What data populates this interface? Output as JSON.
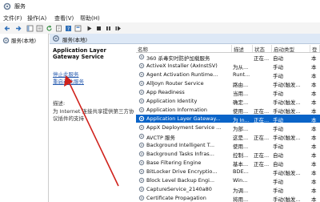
{
  "window": {
    "title": "服务"
  },
  "menu": [
    "文件(F)",
    "操作(A)",
    "查看(V)",
    "帮助(H)"
  ],
  "sidebar": {
    "label": "服务(本地)"
  },
  "header": {
    "label": "服务(本地)"
  },
  "detail": {
    "service_name": "Application Layer Gateway Service",
    "stop_link": "停止此服务",
    "restart_link": "重启动此服务",
    "desc_label": "描述:",
    "desc_text": "为 Internet 连接共享提供第三方协议插件的支持"
  },
  "columns": {
    "name": "名称",
    "description": "描述",
    "status": "状态",
    "startup": "启动类型",
    "logon": "登"
  },
  "rows": [
    {
      "name": "360 杀毒实时防护加载服务",
      "description": "",
      "status": "正在...",
      "startup": "自动",
      "logon": "本"
    },
    {
      "name": "ActiveX Installer (AxInstSV)",
      "description": "为从...",
      "status": "",
      "startup": "手动",
      "logon": "本"
    },
    {
      "name": "Agent Activation Runtime...",
      "description": "Runt...",
      "status": "",
      "startup": "手动",
      "logon": "本"
    },
    {
      "name": "AllJoyn Router Service",
      "description": "路由...",
      "status": "",
      "startup": "手动(触发...",
      "logon": "本"
    },
    {
      "name": "App Readiness",
      "description": "当用...",
      "status": "",
      "startup": "手动",
      "logon": "本"
    },
    {
      "name": "Application Identity",
      "description": "确定...",
      "status": "",
      "startup": "手动(触发...",
      "logon": "本"
    },
    {
      "name": "Application Information",
      "description": "使用...",
      "status": "正在...",
      "startup": "手动(触发...",
      "logon": "本"
    },
    {
      "name": "Application Layer Gateway...",
      "description": "为 In...",
      "status": "正在...",
      "startup": "手动",
      "logon": "本"
    },
    {
      "name": "AppX Deployment Service ...",
      "description": "为部...",
      "status": "",
      "startup": "手动",
      "logon": "本"
    },
    {
      "name": "AVCTP 服务",
      "description": "这是...",
      "status": "正在...",
      "startup": "手动(触发...",
      "logon": "本"
    },
    {
      "name": "Background Intelligent T...",
      "description": "使用...",
      "status": "",
      "startup": "手动",
      "logon": "本"
    },
    {
      "name": "Background Tasks Infras...",
      "description": "控制...",
      "status": "正在...",
      "startup": "自动",
      "logon": "本"
    },
    {
      "name": "Base Filtering Engine",
      "description": "基本...",
      "status": "正在...",
      "startup": "自动",
      "logon": "本"
    },
    {
      "name": "BitLocker Drive Encryptio...",
      "description": "BDE...",
      "status": "",
      "startup": "手动(触发...",
      "logon": "本"
    },
    {
      "name": "Block Level Backup Engi...",
      "description": "Win...",
      "status": "",
      "startup": "手动",
      "logon": "本"
    },
    {
      "name": "CaptureService_2140a80",
      "description": "为调...",
      "status": "",
      "startup": "手动",
      "logon": "本"
    },
    {
      "name": "Certificate Propagation",
      "description": "将用...",
      "status": "",
      "startup": "手动(触发...",
      "logon": "本"
    }
  ],
  "selected_row": 7,
  "colors": {
    "selection": "#0a64c8",
    "annotation_arrow": "#d0221c"
  }
}
